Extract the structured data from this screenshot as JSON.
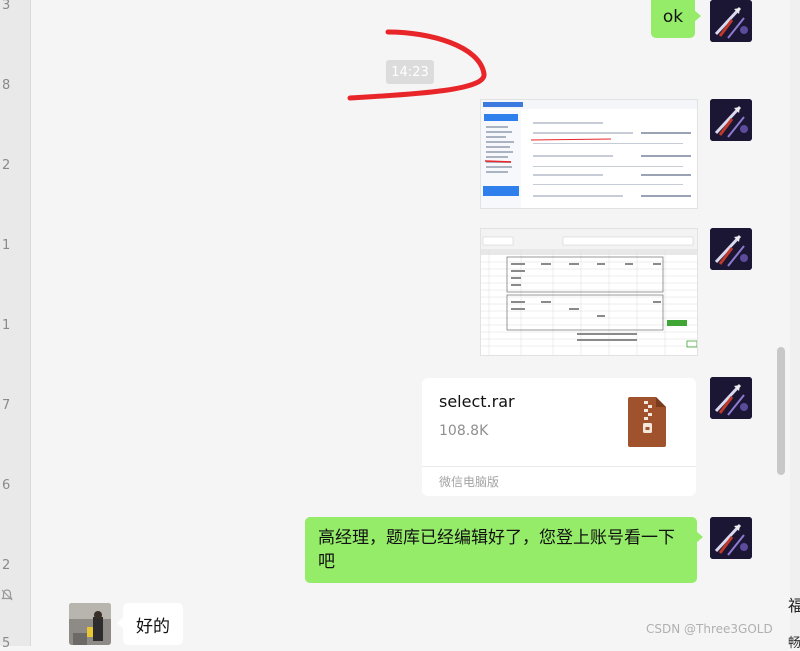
{
  "gutter": {
    "digits": [
      "3",
      "8",
      "2",
      "1",
      "1",
      "7",
      "6",
      "2",
      "5"
    ]
  },
  "right_gutter": {
    "char1": "福",
    "char2": "畅"
  },
  "messages": {
    "ok_text": "ok",
    "time_label": "14:23",
    "file": {
      "name": "select.rar",
      "size": "108.8K",
      "source": "微信电脑版"
    },
    "long_text": "高经理，题库已经编辑好了，您登上账号看一下吧",
    "reply_text": "好的"
  },
  "watermark": "CSDN @Three3GOLD",
  "colors": {
    "self_bubble": "#95ec69",
    "other_bubble": "#ffffff",
    "background": "#f5f5f5",
    "annotation_red": "#e8262a",
    "zip_icon": "#a0522d"
  }
}
